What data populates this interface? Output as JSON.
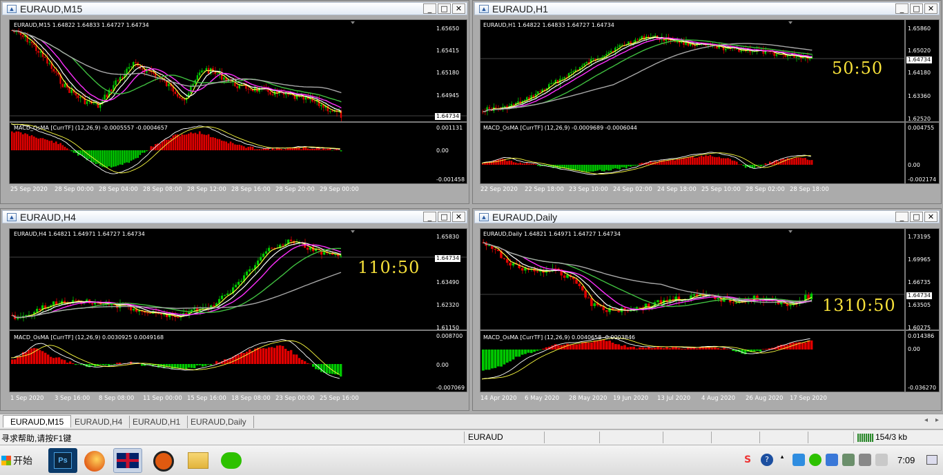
{
  "windows": [
    {
      "key": "m15",
      "title": "EURAUD,M15",
      "header": "EURAUD,M15  1.64822 1.64833 1.64727 1.64734",
      "price_labels": [
        "1.65650",
        "1.65415",
        "1.65180",
        "1.64945",
        "1.64734"
      ],
      "current_price": "1.64734",
      "macd_header": "MACD_OsMA [CurrTF] (12,26,9) -0.0005557 -0.0004657",
      "macd_labels": [
        "0.001131",
        "0.00",
        "-0.001458"
      ],
      "x_labels": [
        "25 Sep 2020",
        "28 Sep 00:00",
        "28 Sep 04:00",
        "28 Sep 08:00",
        "28 Sep 12:00",
        "28 Sep 16:00",
        "28 Sep 20:00",
        "29 Sep 00:00"
      ],
      "ratio": ""
    },
    {
      "key": "h1",
      "title": "EURAUD,H1",
      "header": "EURAUD,H1  1.64822 1.64833 1.64727 1.64734",
      "price_labels": [
        "1.65860",
        "1.65020",
        "1.64180",
        "1.63360",
        "1.62520"
      ],
      "current_price": "1.64734",
      "macd_header": "MACD_OsMA [CurrTF] (12,26,9) -0.0009689 -0.0006044",
      "macd_labels": [
        "0.004755",
        "0.00",
        "-0.002174"
      ],
      "x_labels": [
        "22 Sep 2020",
        "22 Sep 18:00",
        "23 Sep 10:00",
        "24 Sep 02:00",
        "24 Sep 18:00",
        "25 Sep 10:00",
        "28 Sep 02:00",
        "28 Sep 18:00"
      ],
      "ratio": "50:50"
    },
    {
      "key": "h4",
      "title": "EURAUD,H4",
      "header": "EURAUD,H4  1.64821 1.64971 1.64727 1.64734",
      "price_labels": [
        "1.65830",
        "1.64734",
        "1.63490",
        "1.62320",
        "1.61150"
      ],
      "current_price": "1.64734",
      "macd_header": "MACD_OsMA [CurrTF] (12,26,9) 0.0030925 0.0049168",
      "macd_labels": [
        "0.008700",
        "0.00",
        "-0.007069"
      ],
      "x_labels": [
        "1 Sep 2020",
        "3 Sep 16:00",
        "8 Sep 08:00",
        "11 Sep 00:00",
        "15 Sep 16:00",
        "18 Sep 08:00",
        "23 Sep 00:00",
        "25 Sep 16:00"
      ],
      "ratio": "110:50"
    },
    {
      "key": "d1",
      "title": "EURAUD,Daily",
      "header": "EURAUD,Daily  1.64821 1.64971 1.64727 1.64734",
      "price_labels": [
        "1.73195",
        "1.69965",
        "1.66735",
        "1.64734",
        "1.63505",
        "1.60275"
      ],
      "current_price": "1.64734",
      "macd_header": "MACD_OsMA [CurrTF] (12,26,9) 0.0040658 -0.0003846",
      "macd_labels": [
        "0.014386",
        "0.00",
        "-0.036270"
      ],
      "x_labels": [
        "14 Apr 2020",
        "6 May 2020",
        "28 May 2020",
        "19 Jun 2020",
        "13 Jul 2020",
        "4 Aug 2020",
        "26 Aug 2020",
        "17 Sep 2020"
      ],
      "ratio": "1310:50"
    }
  ],
  "window_buttons": {
    "minimize": "_",
    "restore": "□",
    "close": "✕"
  },
  "tabs": [
    "EURAUD,M15",
    "EURAUD,H4",
    "EURAUD,H1",
    "EURAUD,Daily"
  ],
  "status": {
    "help": "寻求帮助,请按F1键",
    "symbol": "EURAUD",
    "traffic": "154/3 kb"
  },
  "taskbar": {
    "start": "开始",
    "clock": "7:09"
  },
  "colors": {
    "bull": "#00c800",
    "bear": "#e00000",
    "ma_yellow": "#ffff40",
    "ma_magenta": "#ff30ff",
    "ma_green": "#40c040",
    "ma_gray": "#a8a8a8",
    "ratio": "#f7e13a"
  }
}
